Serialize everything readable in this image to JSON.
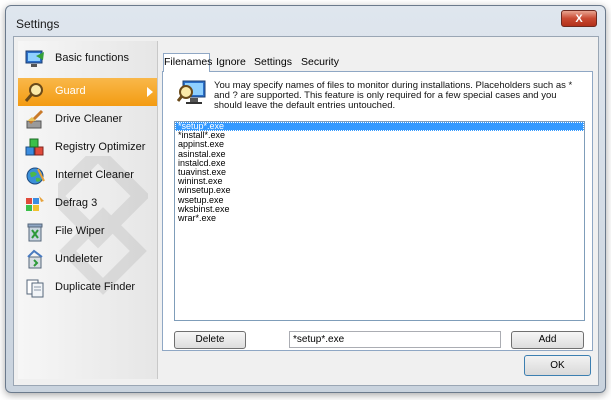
{
  "window": {
    "title": "Settings",
    "close_label": "X"
  },
  "sidebar": {
    "items": [
      {
        "label": "Basic functions",
        "icon": "monitor-icon"
      },
      {
        "label": "Guard",
        "icon": "magnifier-icon"
      },
      {
        "label": "Drive Cleaner",
        "icon": "broom-icon"
      },
      {
        "label": "Registry Optimizer",
        "icon": "registry-cubes-icon"
      },
      {
        "label": "Internet Cleaner",
        "icon": "globe-icon"
      },
      {
        "label": "Defrag 3",
        "icon": "defrag-icon"
      },
      {
        "label": "File Wiper",
        "icon": "trash-icon"
      },
      {
        "label": "Undeleter",
        "icon": "recover-icon"
      },
      {
        "label": "Duplicate Finder",
        "icon": "documents-icon"
      }
    ],
    "active": "Guard"
  },
  "tabs": [
    {
      "label": "Filenames"
    },
    {
      "label": "Ignore"
    },
    {
      "label": "Settings"
    },
    {
      "label": "Security"
    }
  ],
  "info": {
    "text": "You may specify names of files to monitor during installations. Placeholders such as * and ? are supported. This feature is only required for a few special cases and you should leave the default entries untouched."
  },
  "filenames": [
    "*setup*.exe",
    "*install*.exe",
    "appinst.exe",
    "asinstal.exe",
    "instalcd.exe",
    "tuavinst.exe",
    "wininst.exe",
    "winsetup.exe",
    "wsetup.exe",
    "wksbinst.exe",
    "wrar*.exe"
  ],
  "selected_filename": "*setup*.exe",
  "buttons": {
    "delete": "Delete",
    "add": "Add",
    "ok": "OK"
  },
  "input": {
    "value": "*setup*.exe"
  },
  "colors": {
    "active_item": "#f39b12",
    "selection": "#3399ff",
    "tab_border": "#8fa7c4"
  }
}
